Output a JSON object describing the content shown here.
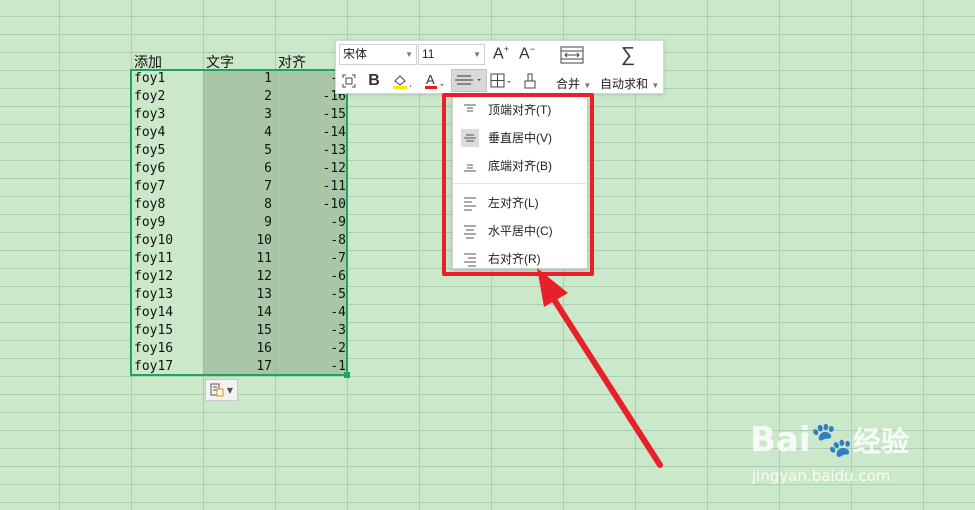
{
  "headers": [
    "添加",
    "文字",
    "对齐"
  ],
  "rows": [
    {
      "name": "foy1",
      "num": "1",
      "neg": "-1"
    },
    {
      "name": "foy2",
      "num": "2",
      "neg": "-16"
    },
    {
      "name": "foy3",
      "num": "3",
      "neg": "-15"
    },
    {
      "name": "foy4",
      "num": "4",
      "neg": "-14"
    },
    {
      "name": "foy5",
      "num": "5",
      "neg": "-13"
    },
    {
      "name": "foy6",
      "num": "6",
      "neg": "-12"
    },
    {
      "name": "foy7",
      "num": "7",
      "neg": "-11"
    },
    {
      "name": "foy8",
      "num": "8",
      "neg": "-10"
    },
    {
      "name": "foy9",
      "num": "9",
      "neg": "-9"
    },
    {
      "name": "foy10",
      "num": "10",
      "neg": "-8"
    },
    {
      "name": "foy11",
      "num": "11",
      "neg": "-7"
    },
    {
      "name": "foy12",
      "num": "12",
      "neg": "-6"
    },
    {
      "name": "foy13",
      "num": "13",
      "neg": "-5"
    },
    {
      "name": "foy14",
      "num": "14",
      "neg": "-4"
    },
    {
      "name": "foy15",
      "num": "15",
      "neg": "-3"
    },
    {
      "name": "foy16",
      "num": "16",
      "neg": "-2"
    },
    {
      "name": "foy17",
      "num": "17",
      "neg": "-1"
    }
  ],
  "toolbar": {
    "font": "宋体",
    "size": "11",
    "merge_label": "合并",
    "autosum_label": "自动求和"
  },
  "align_menu": {
    "items": [
      {
        "label": "顶端对齐(T)",
        "icon": "align-top-icon"
      },
      {
        "label": "垂直居中(V)",
        "icon": "align-middle-icon"
      },
      {
        "label": "底端对齐(B)",
        "icon": "align-bottom-icon"
      },
      {
        "label": "左对齐(L)",
        "icon": "align-left-icon"
      },
      {
        "label": "水平居中(C)",
        "icon": "align-center-icon"
      },
      {
        "label": "右对齐(R)",
        "icon": "align-right-icon"
      }
    ]
  },
  "colors": {
    "sheet_bg": "#cbe8cb",
    "selection": "#1fa55b",
    "highlight": "#e8202a",
    "font_color_bar": "#e02020",
    "fill_color_bar": "#ffe800"
  },
  "watermark": {
    "brand": "Bai",
    "brand_cn": "经验",
    "url": "jingyan.baidu.com"
  }
}
